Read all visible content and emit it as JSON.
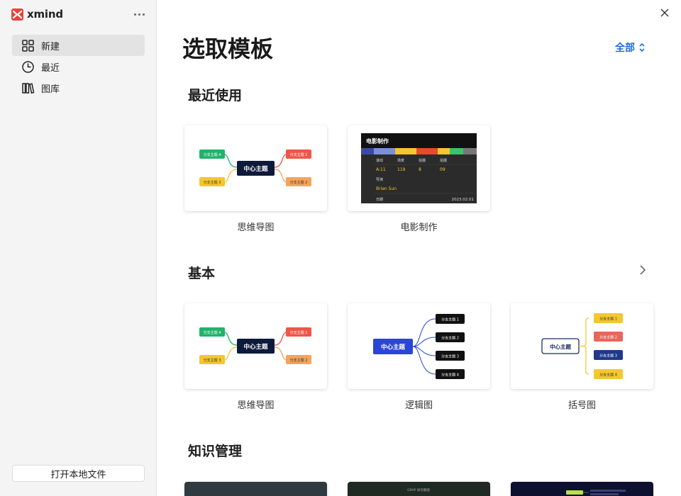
{
  "app": {
    "name": "xmind"
  },
  "sidebar": {
    "items": [
      {
        "label": "新建",
        "icon": "grid-icon",
        "active": true
      },
      {
        "label": "最近",
        "icon": "clock-icon",
        "active": false
      },
      {
        "label": "图库",
        "icon": "library-icon",
        "active": false
      }
    ],
    "open_local_label": "打开本地文件"
  },
  "main": {
    "title": "选取模板",
    "filter_label": "全部",
    "sections": [
      {
        "title": "最近使用"
      },
      {
        "title": "基本"
      },
      {
        "title": "知识管理"
      }
    ],
    "recent_templates": [
      {
        "label": "思维导图"
      },
      {
        "label": "电影制作"
      }
    ],
    "basic_templates": [
      {
        "label": "思维导图"
      },
      {
        "label": "逻辑图"
      },
      {
        "label": "括号图"
      }
    ]
  },
  "thumbs": {
    "central_topic": "中心主题",
    "branches": [
      "分支主题 1",
      "分支主题 2",
      "分支主题 3",
      "分支主题 4"
    ],
    "film": {
      "title": "电影制作",
      "headers": [
        "滚动",
        "场景",
        "拍摄",
        "拍摄"
      ],
      "row1": [
        "A:11",
        "119",
        "8",
        "09"
      ],
      "label_director": "导演",
      "director": "Brian Sun",
      "label_date": "日期",
      "date": "2023.02.01"
    },
    "kn2_title": "GRAP 如何看图"
  },
  "colors": {
    "accent": "#1f6fd1",
    "branch_green": "#21b36b",
    "branch_red": "#f0554a",
    "branch_yellow": "#f6c62f",
    "branch_orange": "#f5a45b",
    "central_dark": "#0e1a3a",
    "logic_blue": "#2a45d8"
  }
}
